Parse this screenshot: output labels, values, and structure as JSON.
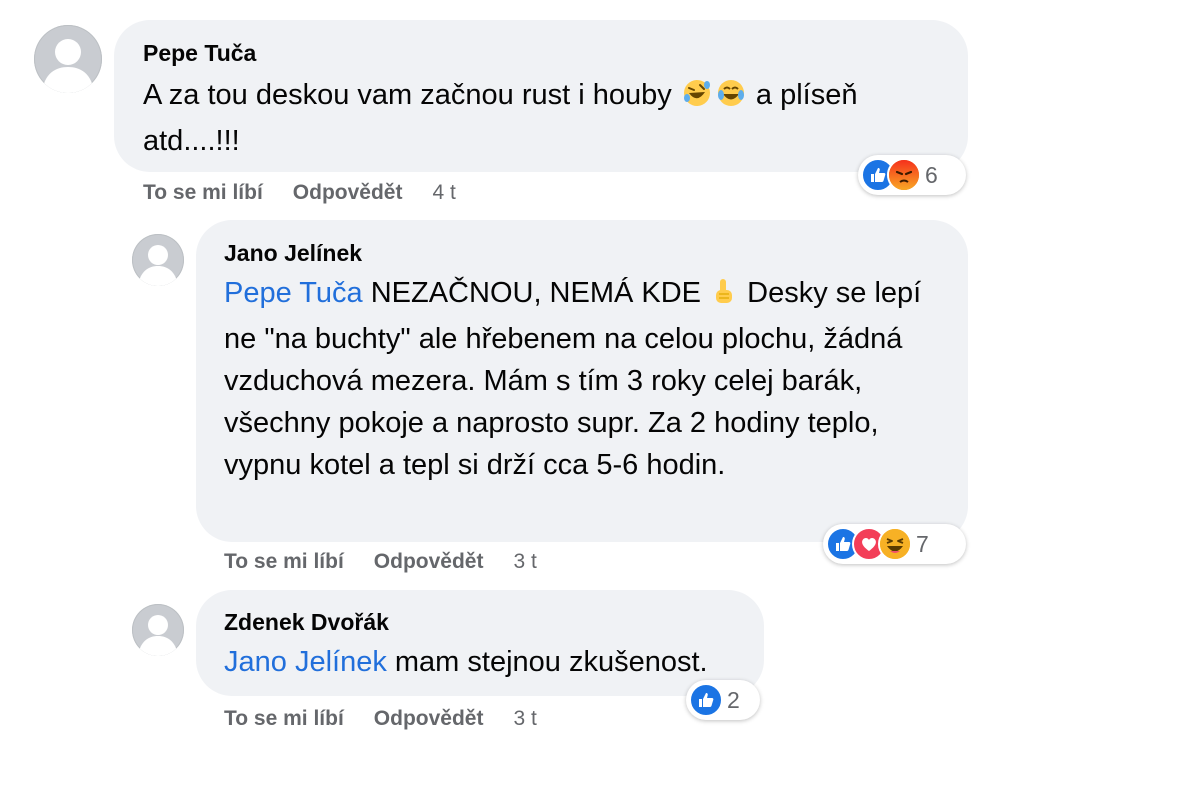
{
  "comments": [
    {
      "author": "Pepe Tuča",
      "text_part1": "A za tou deskou vam začnou rust i houby",
      "text_part2": " a plíseň atd....!!!",
      "emoji_icons": [
        "rolling-laugh-emoji-icon",
        "tears-of-joy-emoji-icon"
      ],
      "actions": {
        "like": "To se mi líbí",
        "reply": "Odpovědět",
        "time": "4 t"
      },
      "reactions": {
        "icons": [
          "like-icon",
          "angry-icon"
        ],
        "count": "6"
      }
    },
    {
      "author": "Jano Jelínek",
      "mention": "Pepe Tuča",
      "text_part1": " NEZAČNOU, NEMÁ KDE",
      "text_part2": " Desky se lepí ne \"na buchty\" ale hřebenem na celou plochu, žádná vzduchová mezera. Mám s tím 3 roky celej barák, všechny pokoje a naprosto supr. Za 2 hodiny teplo, vypnu kotel a tepl si drží cca 5-6 hodin.",
      "emoji_icons": [
        "pointing-up-emoji-icon"
      ],
      "actions": {
        "like": "To se mi líbí",
        "reply": "Odpovědět",
        "time": "3 t"
      },
      "reactions": {
        "icons": [
          "like-icon",
          "love-icon",
          "haha-icon"
        ],
        "count": "7"
      }
    },
    {
      "author": "Zdenek Dvořák",
      "mention": "Jano Jelínek",
      "text_part1": " mam stejnou zkušenost.",
      "actions": {
        "like": "To se mi líbí",
        "reply": "Odpovědět",
        "time": "3 t"
      },
      "reactions": {
        "icons": [
          "like-icon"
        ],
        "count": "2"
      }
    }
  ],
  "colors": {
    "bubble": "#f0f2f5",
    "mention": "#216fdb",
    "like": "#1b74e4",
    "love": "#f33e58",
    "angry": "#e9710f",
    "haha": "#f7b125"
  }
}
